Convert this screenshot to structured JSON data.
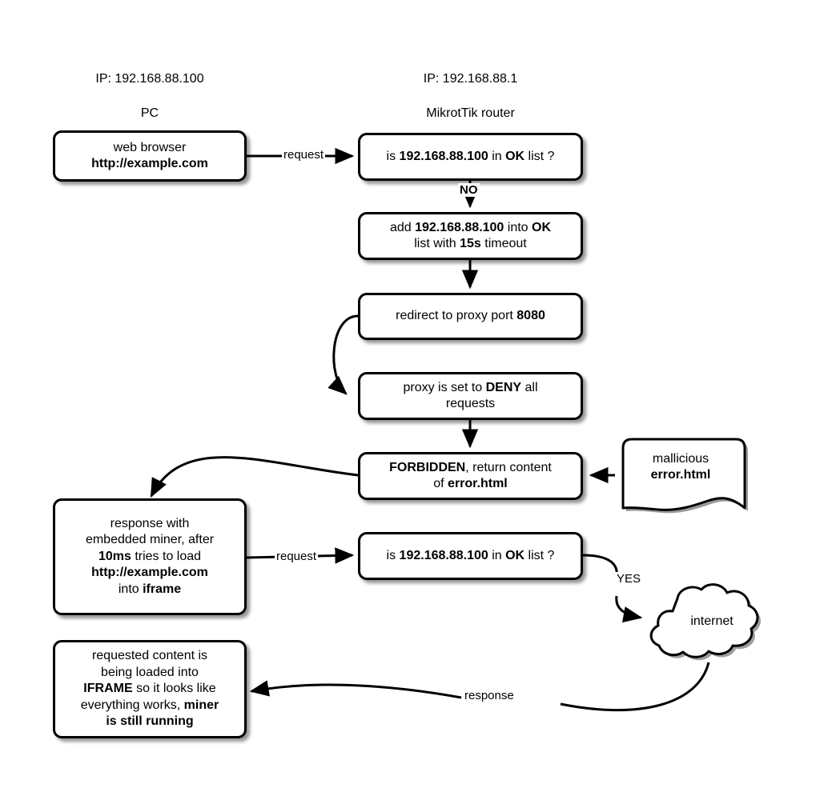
{
  "diagram": {
    "title_columns": [
      {
        "name": "pc-column-header",
        "line1": "IP: 192.168.88.100",
        "line2": "PC"
      },
      {
        "name": "router-column-header",
        "line1": "IP: 192.168.88.1",
        "line2": "MikrotTik router"
      }
    ],
    "nodes": {
      "web_browser": {
        "line1": "web browser",
        "line2": "http://example.com"
      },
      "check_ok_list_1": {
        "pre": "is ",
        "ip": "192.168.88.100",
        "mid": " in ",
        "list": "OK",
        "post": " list ?"
      },
      "add_to_ok_list": {
        "l1a": "add ",
        "l1ip": "192.168.88.100",
        "l1b": " into ",
        "l1c": "OK",
        "l2a": "list with ",
        "l2b": "15s",
        "l2c": " timeout"
      },
      "redirect_proxy": {
        "a": "redirect to proxy port ",
        "b": "8080"
      },
      "proxy_deny": {
        "a": "proxy is set to  ",
        "b": "DENY",
        "c": " all",
        "d": "requests"
      },
      "forbidden": {
        "a": "FORBIDDEN",
        "b": ", return content",
        "c": "of  ",
        "d": "error.html"
      },
      "mallicious_doc": {
        "line1": "mallicious",
        "line2": "error.html"
      },
      "response_miner": {
        "l1": "response with",
        "l2": "embedded miner, after",
        "l3a": "10ms",
        "l3b": " tries to load",
        "l4": "http://example.com",
        "l5a": "into ",
        "l5b": "iframe"
      },
      "check_ok_list_2": {
        "pre": "is ",
        "ip": "192.168.88.100",
        "mid": " in ",
        "list": "OK",
        "post": " list ?"
      },
      "internet_cloud": {
        "label": "internet"
      },
      "iframe_result": {
        "l1": "requested content is",
        "l2": "being loaded into",
        "l3a": "IFRAME",
        "l3b": " so it looks like",
        "l4a": "everything works, ",
        "l4b": "miner",
        "l5": "is still running"
      }
    },
    "edge_labels": {
      "request_1": "request",
      "no": "NO",
      "request_2": "request",
      "yes": "YES",
      "response": "response"
    },
    "colors": {
      "stroke": "#000000",
      "background": "#ffffff",
      "shadow": "rgba(0,0,0,0.42)"
    }
  }
}
